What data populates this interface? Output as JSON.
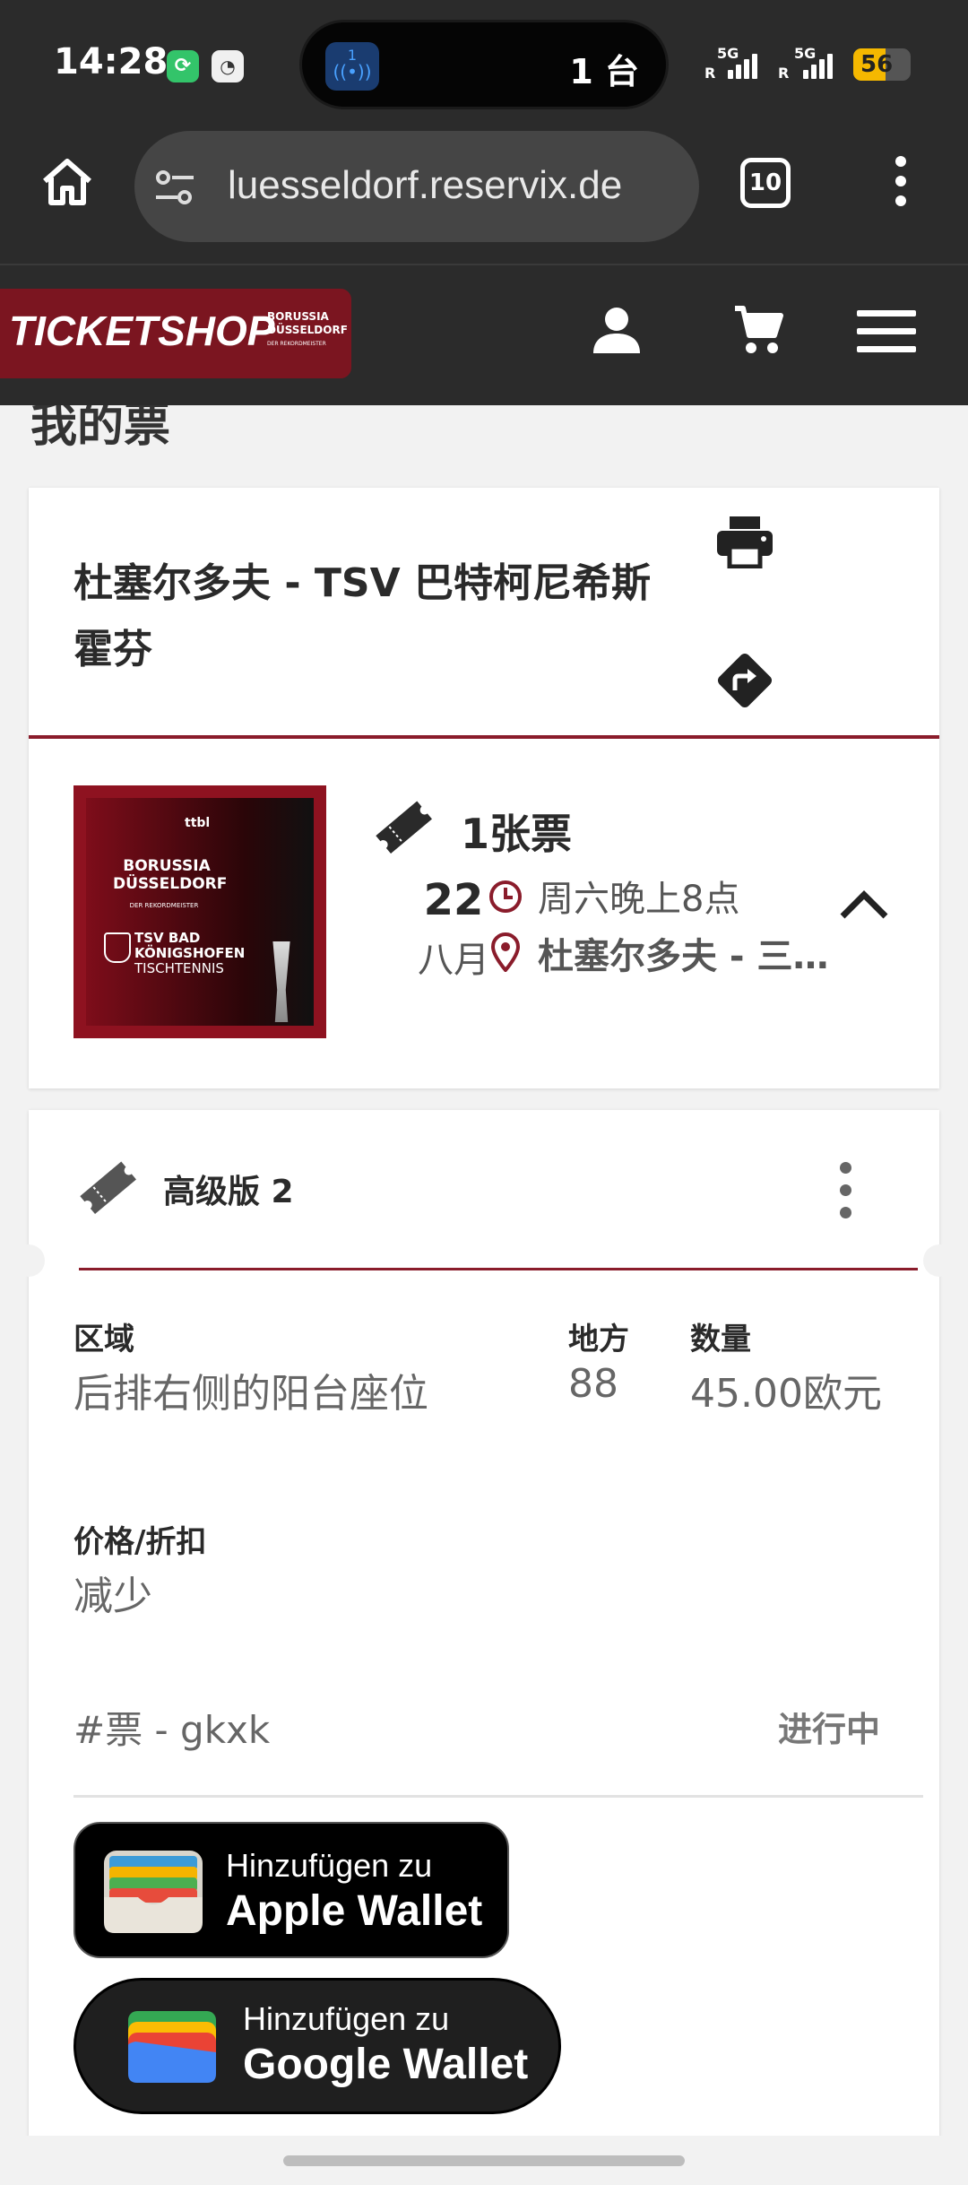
{
  "status_bar": {
    "time": "14:28",
    "island_badge": "1",
    "island_text": "1 台",
    "signal1_label": "5G",
    "signal2_label": "5G",
    "roaming1": "R",
    "roaming2": "R",
    "battery": "56",
    "battery_color": "#f5b800"
  },
  "browser": {
    "url": "luesseldorf.reservix.de",
    "tab_count": "10"
  },
  "site": {
    "logo_text": "TICKETSHOP",
    "logo_sub1": "BORUSSIA",
    "logo_sub2": "DÜSSELDORF",
    "logo_sub3": "DER REKORDMEISTER",
    "brand_color": "#7b1520"
  },
  "page": {
    "title": "我的票"
  },
  "event": {
    "title": "杜塞尔多夫 - TSV 巴特柯尼希斯霍芬",
    "ticket_count": "1张票",
    "day": "22",
    "month": "八月",
    "time": "周六晚上8点",
    "venue": "杜塞尔多夫 - 三…",
    "poster": {
      "league": "ttbl",
      "team1a": "BORUSSIA",
      "team1b": "DÜSSELDORF",
      "team1_sub": "DER REKORDMEISTER",
      "team2a": "TSV BAD",
      "team2b": "KÖNIGSHOFEN",
      "team2c": "TISCHTENNIS"
    }
  },
  "ticket": {
    "category": "高级版 2",
    "fields": {
      "area_label": "区域",
      "area_value": "后排右侧的阳台座位",
      "place_label": "地方",
      "place_value": "88",
      "amount_label": "数量",
      "amount_value": "45.00欧元",
      "price_label": "价格/折扣",
      "price_value": "减少"
    },
    "id_text": "#票 -  gkxk",
    "status": "进行中"
  },
  "wallets": {
    "apple_top": "Hinzufügen zu",
    "apple_bottom": "Apple Wallet",
    "google_top": "Hinzufügen zu",
    "google_bottom": "Google Wallet"
  }
}
